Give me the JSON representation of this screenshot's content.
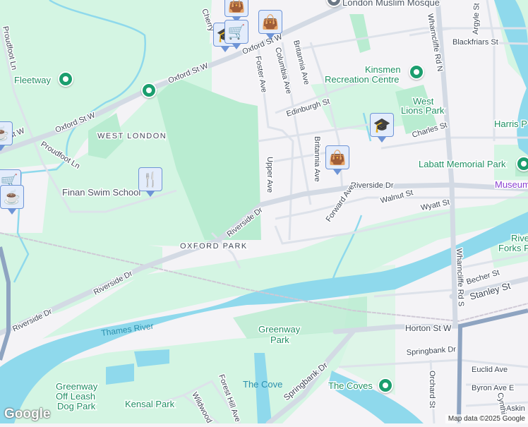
{
  "map": {
    "colors": {
      "background": "#f4f3f6",
      "park": "#d4f5e3",
      "park_dark": "#b9ecd1",
      "water": "#8fd9ec",
      "road": "#d5dce6",
      "highway": "#8ea4c1"
    },
    "areas": {
      "west_london": "WEST LONDON",
      "oxford_park": "OXFORD PARK"
    },
    "streets": {
      "oxford_1": "Oxford St W",
      "oxford_2": "Oxford St W",
      "oxford_3": "Oxford St W",
      "proudfoot": "Proudfoot Ln",
      "proudfoot_top": "Proudfoot Ln",
      "cherry": "Cherry",
      "foster": "Foster Ave",
      "columbia": "Columbia Ave",
      "britannia_1": "Britannia Ave",
      "britannia_2": "Britannia Ave",
      "edinburgh": "Edinburgh St",
      "upper": "Upper Ave",
      "riverside_1": "Riverside Dr",
      "riverside_2": "Riverside Dr",
      "riverside_3": "Riverside Dr",
      "riverside_4": "Riverside Dr",
      "forward": "Forward Ave",
      "walnut": "Walnut St",
      "wyatt": "Wyatt St",
      "charles": "Charles St",
      "blackfriars": "Blackfriars St",
      "argyle": "Argyle St",
      "wharncliffe_n": "Wharncliffe Rd N",
      "wharncliffe_s": "Wharncliffe Rd S",
      "becher": "Becher St",
      "stanley": "Stanley St",
      "horton": "Horton St W",
      "springbank_1": "Springbank Dr",
      "springbank_2": "Springbank Dr",
      "euclid": "Euclid Ave",
      "byron": "Byron Ave E",
      "orchard": "Orchard St",
      "askin": "Askin",
      "cynthia": "Cynthi",
      "forest_hill": "Forest Hill Ave",
      "wildwood": "Wildwood"
    },
    "places": {
      "mosque": "London Muslim Mosque",
      "fleetway": "Fleetway",
      "kinsmen_1": "Kinsmen",
      "kinsmen_2": "Recreation Centre",
      "west_lions_1": "West",
      "west_lions_2": "Lions Park",
      "harris": "Harris P",
      "labatt": "Labatt Memorial Park",
      "museum": "Museum",
      "river_forks_1": "River",
      "river_forks_2": "Forks P",
      "finan": "Finan Swim School",
      "greenway_1": "Greenway",
      "greenway_2": "Park",
      "dog_park_1": "Greenway",
      "dog_park_2": "Off Leash",
      "dog_park_3": "Dog Park",
      "kensal": "Kensal Park",
      "the_cove": "The Cove",
      "the_coves": "The Coves"
    },
    "water": {
      "thames": "Thames River"
    },
    "markers": [
      {
        "icon": "shopping-cart-icon",
        "glyph": "🛒"
      },
      {
        "icon": "shopping-bag-icon",
        "glyph": "👜"
      },
      {
        "icon": "shopping-bag-icon",
        "glyph": "👜"
      },
      {
        "icon": "graduation-cap-icon",
        "glyph": "🎓"
      },
      {
        "icon": "restaurant-icon",
        "glyph": "🍴"
      },
      {
        "icon": "coffee-icon",
        "glyph": "☕"
      },
      {
        "icon": "shopping-cart-icon",
        "glyph": "🛒"
      },
      {
        "icon": "coffee-icon",
        "glyph": "☕"
      }
    ],
    "logo": "Google",
    "attribution": "Map data ©2025 Google"
  }
}
